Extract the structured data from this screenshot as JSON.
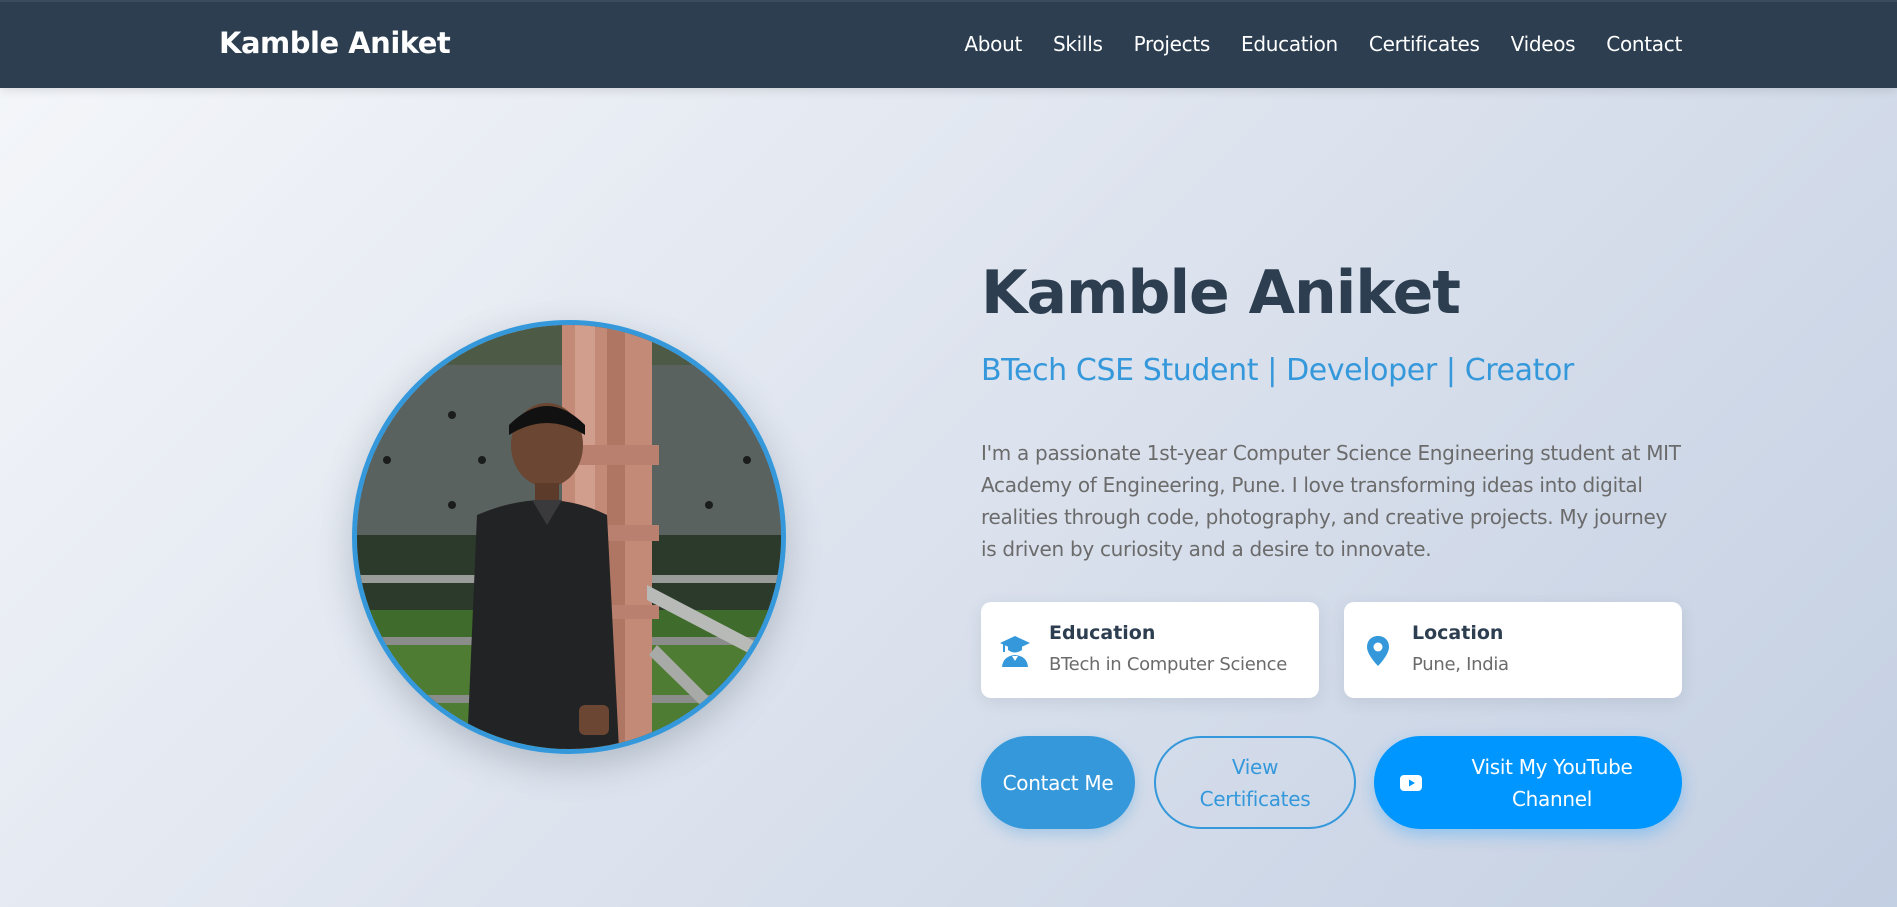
{
  "navbar": {
    "brand": "Kamble Aniket",
    "links": [
      {
        "label": "About"
      },
      {
        "label": "Skills"
      },
      {
        "label": "Projects"
      },
      {
        "label": "Education"
      },
      {
        "label": "Certificates"
      },
      {
        "label": "Videos"
      },
      {
        "label": "Contact"
      }
    ]
  },
  "hero": {
    "title": "Kamble Aniket",
    "subtitle": "BTech CSE Student | Developer | Creator",
    "description": "I'm a passionate 1st-year Computer Science Engineering student at MIT Academy of Engineering, Pune. I love transforming ideas into digital realities through code, photography, and creative projects. My journey is driven by curiosity and a desire to innovate.",
    "cards": {
      "education": {
        "title": "Education",
        "value": "BTech in Computer Science",
        "icon": "graduate-icon"
      },
      "location": {
        "title": "Location",
        "value": "Pune, India",
        "icon": "map-pin-icon"
      }
    },
    "buttons": {
      "contact": "Contact Me",
      "certificates": "View Certificates",
      "youtube": "Visit My YouTube Channel",
      "youtube_icon": "youtube-icon"
    }
  },
  "colors": {
    "navbar": "#2c3e50",
    "accent": "#3498db",
    "youtube_button": "#0096ff",
    "heading": "#2c3e50",
    "body_text": "#6b6b6b"
  }
}
